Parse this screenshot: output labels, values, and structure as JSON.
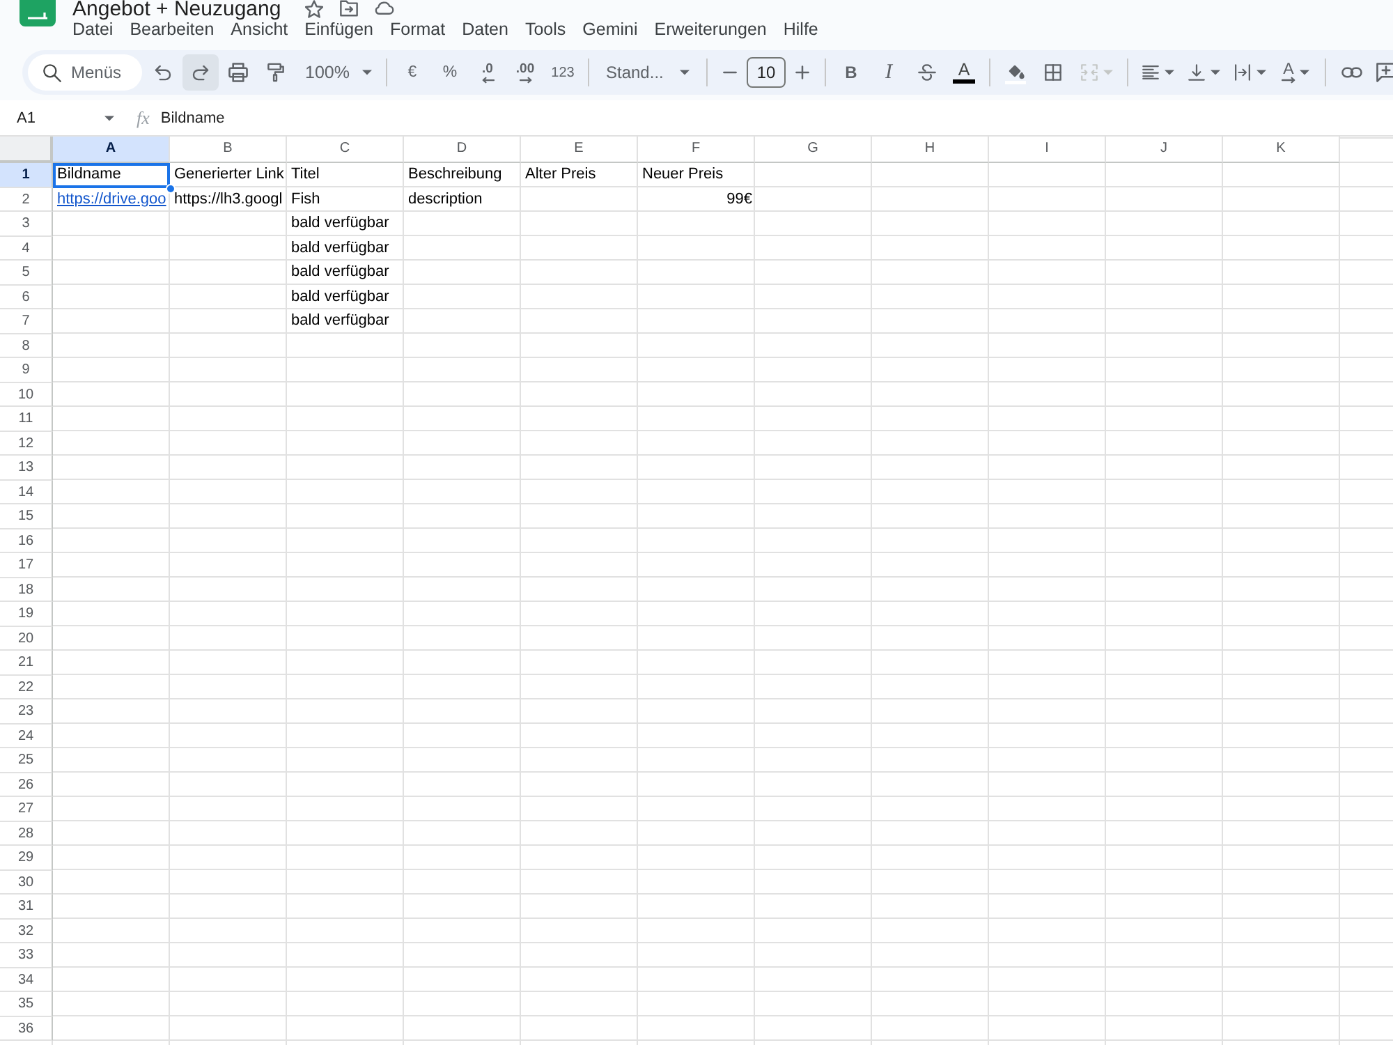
{
  "document": {
    "title": "Angebot + Neuzugang"
  },
  "menu": [
    "Datei",
    "Bearbeiten",
    "Ansicht",
    "Einfügen",
    "Format",
    "Daten",
    "Tools",
    "Gemini",
    "Erweiterungen",
    "Hilfe"
  ],
  "toolbar": {
    "search": {
      "placeholder": "Menüs"
    },
    "redo": {
      "highlighted": true
    },
    "zoom": "100%",
    "currency": "€",
    "percent": "%",
    "decrease_decimals": ".0",
    "increase_decimals": ".00",
    "number_format": "123",
    "font": "Stand...",
    "font_size": "10",
    "bold": "B",
    "italic": "I",
    "text_color": "A",
    "merge": {
      "disabled": true
    },
    "text_rotation": "A"
  },
  "formula_bar": {
    "name_box": "A1",
    "function_label": "fx",
    "formula": "Bildname"
  },
  "grid": {
    "columns": [
      {
        "label": "A",
        "selected": true
      },
      {
        "label": "B",
        "selected": false
      },
      {
        "label": "C",
        "selected": false
      },
      {
        "label": "D",
        "selected": false
      },
      {
        "label": "E",
        "selected": false
      },
      {
        "label": "F",
        "selected": false
      },
      {
        "label": "G",
        "selected": false
      },
      {
        "label": "H",
        "selected": false
      },
      {
        "label": "I",
        "selected": false
      },
      {
        "label": "J",
        "selected": false
      },
      {
        "label": "K",
        "selected": false
      }
    ],
    "rows": [
      {
        "label": "1",
        "selected": true,
        "cells": {
          "A": {
            "kind": "text",
            "text": "Bildname",
            "selected": true
          },
          "B": {
            "kind": "text",
            "text": "Generierter Link",
            "selected": false
          },
          "C": {
            "kind": "text",
            "text": "Titel",
            "selected": false
          },
          "D": {
            "kind": "text",
            "text": "Beschreibung",
            "selected": false
          },
          "E": {
            "kind": "text",
            "text": "Alter Preis",
            "selected": false
          },
          "F": {
            "kind": "text",
            "text": "Neuer Preis",
            "selected": false
          }
        }
      },
      {
        "label": "2",
        "selected": false,
        "cells": {
          "A": {
            "kind": "link",
            "text": "https://drive.goo",
            "selected": false
          },
          "B": {
            "kind": "text",
            "text": "https://lh3.googl",
            "selected": false
          },
          "C": {
            "kind": "text",
            "text": "Fish",
            "selected": false
          },
          "D": {
            "kind": "text",
            "text": "description",
            "selected": false
          },
          "F": {
            "kind": "number",
            "text": "99€",
            "selected": false
          }
        }
      },
      {
        "label": "3",
        "selected": false,
        "cells": {
          "C": {
            "kind": "text",
            "text": "bald verfügbar",
            "selected": false
          }
        }
      },
      {
        "label": "4",
        "selected": false,
        "cells": {
          "C": {
            "kind": "text",
            "text": "bald verfügbar",
            "selected": false
          }
        }
      },
      {
        "label": "5",
        "selected": false,
        "cells": {
          "C": {
            "kind": "text",
            "text": "bald verfügbar",
            "selected": false
          }
        }
      },
      {
        "label": "6",
        "selected": false,
        "cells": {
          "C": {
            "kind": "text",
            "text": "bald verfügbar",
            "selected": false
          }
        }
      },
      {
        "label": "7",
        "selected": false,
        "cells": {
          "C": {
            "kind": "text",
            "text": "bald verfügbar",
            "selected": false
          }
        }
      },
      {
        "label": "8",
        "selected": false
      },
      {
        "label": "9",
        "selected": false
      },
      {
        "label": "10",
        "selected": false
      },
      {
        "label": "11",
        "selected": false
      },
      {
        "label": "12",
        "selected": false
      },
      {
        "label": "13",
        "selected": false
      },
      {
        "label": "14",
        "selected": false
      },
      {
        "label": "15",
        "selected": false
      },
      {
        "label": "16",
        "selected": false
      },
      {
        "label": "17",
        "selected": false
      },
      {
        "label": "18",
        "selected": false
      },
      {
        "label": "19",
        "selected": false
      },
      {
        "label": "20",
        "selected": false
      },
      {
        "label": "21",
        "selected": false
      },
      {
        "label": "22",
        "selected": false
      },
      {
        "label": "23",
        "selected": false
      },
      {
        "label": "24",
        "selected": false
      },
      {
        "label": "25",
        "selected": false
      },
      {
        "label": "26",
        "selected": false
      },
      {
        "label": "27",
        "selected": false
      },
      {
        "label": "28",
        "selected": false
      },
      {
        "label": "29",
        "selected": false
      },
      {
        "label": "30",
        "selected": false
      },
      {
        "label": "31",
        "selected": false
      },
      {
        "label": "32",
        "selected": false
      },
      {
        "label": "33",
        "selected": false
      },
      {
        "label": "34",
        "selected": false
      },
      {
        "label": "35",
        "selected": false
      },
      {
        "label": "36",
        "selected": false
      }
    ]
  }
}
